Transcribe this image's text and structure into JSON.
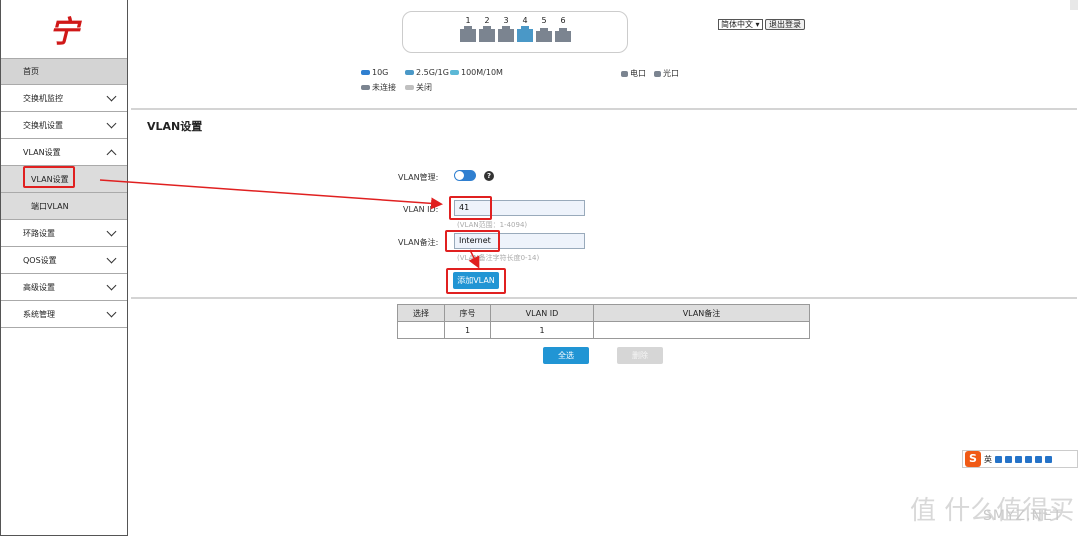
{
  "logo": {
    "text": "宁"
  },
  "sidebar": {
    "home": "首页",
    "items": [
      {
        "label": "交换机监控",
        "expanded": false
      },
      {
        "label": "交换机设置",
        "expanded": false
      },
      {
        "label": "VLAN设置",
        "expanded": true
      },
      {
        "label": "环路设置",
        "expanded": false
      },
      {
        "label": "QOS设置",
        "expanded": false
      },
      {
        "label": "高级设置",
        "expanded": false
      },
      {
        "label": "系统管理",
        "expanded": false
      }
    ],
    "subitems": [
      {
        "label": "VLAN设置",
        "active": true
      },
      {
        "label": "端口VLAN",
        "active": false
      }
    ]
  },
  "ports": {
    "numbers": [
      "1",
      "2",
      "3",
      "4",
      "5",
      "6"
    ],
    "active_port": "4"
  },
  "legend": {
    "speed_10g": "10G",
    "speed_2_5g": "2.5G/1G",
    "speed_100m": "100M/10M",
    "not_connected": "未连接",
    "closed": "关闭",
    "electric": "电口",
    "optical": "光口",
    "colors": {
      "10g": "#2f7fd0",
      "2_5g": "#4a98c7",
      "100m": "#5cb8d6",
      "not_connected": "#7b8490",
      "closed": "#c0c0c0"
    }
  },
  "header": {
    "language": "简体中文",
    "logout": "退出登录"
  },
  "page": {
    "title": "VLAN设置"
  },
  "form": {
    "vlan_mgmt_label": "VLAN管理:",
    "vlan_mgmt_on": true,
    "help": "?",
    "vlan_id_label": "VLAN ID:",
    "vlan_id_value": "41",
    "vlan_id_hint": "(VLAN范围：1-4094)",
    "vlan_note_label": "VLAN备注:",
    "vlan_note_value": "Internet",
    "vlan_note_hint": "(VLAN备注字符长度0-14)",
    "add_button": "添加VLAN"
  },
  "table": {
    "headers": [
      "选择",
      "序号",
      "VLAN ID",
      "VLAN备注"
    ],
    "rows": [
      {
        "select": "",
        "index": "1",
        "vlan_id": "1",
        "note": ""
      }
    ],
    "select_all": "全选",
    "delete": "删除"
  },
  "ime": {
    "logo": "S",
    "mode": "英"
  },
  "watermark": {
    "text": "值 什么值得买",
    "site": "SMYZ.NET"
  },
  "accent_red": "#e02020"
}
